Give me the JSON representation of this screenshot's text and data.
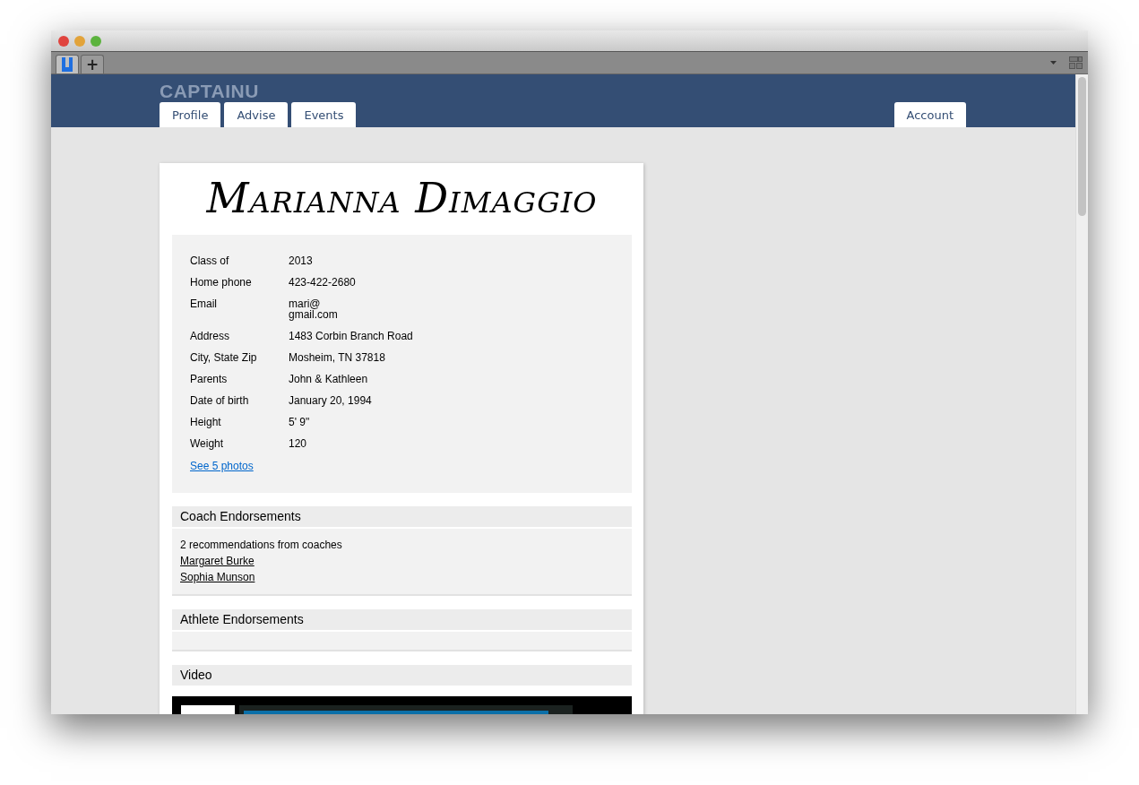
{
  "browser": {
    "tabs": [
      {
        "kind": "site",
        "selected": true
      },
      {
        "kind": "new",
        "label": "+",
        "selected": false
      }
    ]
  },
  "site": {
    "logo": "CAPTAINU",
    "nav": [
      {
        "label": "Profile"
      },
      {
        "label": "Advise"
      },
      {
        "label": "Events"
      }
    ],
    "account": {
      "label": "Account"
    }
  },
  "profile": {
    "name": "Marianna Dimaggio",
    "details": [
      {
        "label": "Class of",
        "value": "2013"
      },
      {
        "label": "Home phone",
        "value": "423-422-2680"
      },
      {
        "label": "Email",
        "value": "mari@\ngmail.com"
      },
      {
        "label": "Address",
        "value": "1483 Corbin Branch Road"
      },
      {
        "label": "City, State Zip",
        "value": "Mosheim, TN 37818"
      },
      {
        "label": "Parents",
        "value": "John & Kathleen"
      },
      {
        "label": "Date of birth",
        "value": "January 20, 1994"
      },
      {
        "label": "Height",
        "value": "5' 9\""
      },
      {
        "label": "Weight",
        "value": "120"
      }
    ],
    "photos_link": "See 5 photos"
  },
  "sections": [
    {
      "kind": "endorsements",
      "title": "Coach Endorsements",
      "summary": "2 recommendations from coaches",
      "links": [
        "Margaret Burke",
        "Sophia Munson"
      ]
    },
    {
      "kind": "endorsements",
      "title": "Athlete Endorsements"
    },
    {
      "kind": "video",
      "title": "Video"
    }
  ]
}
